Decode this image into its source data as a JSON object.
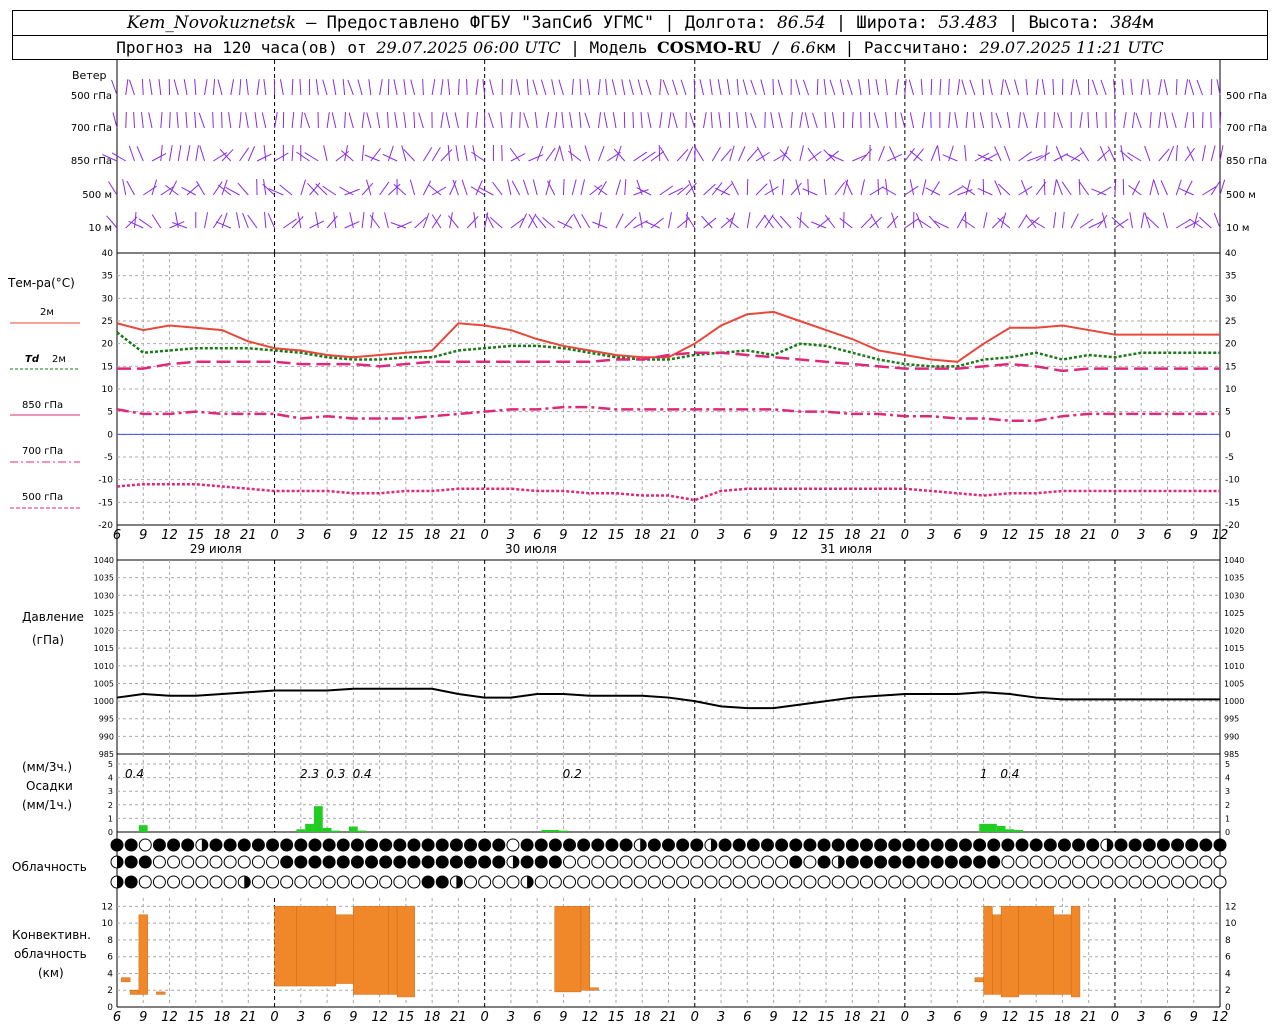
{
  "header": {
    "station": "Kem_Novokuznetsk",
    "provider": "Предоставлено ФГБУ \"ЗапСиб УГМС\"",
    "lon_label": "Долгота:",
    "lon": "86.54",
    "lat_label": "Широта:",
    "lat": "53.483",
    "alt_label": "Высота:",
    "alt": "384",
    "alt_unit": "м",
    "forecast_prefix": "Прогноз на 120 часа(ов) от",
    "forecast_start": "29.07.2025 06:00 UTC",
    "model_label": "Модель",
    "model": "COSMO-RU",
    "resolution": "6.6",
    "res_unit": "км",
    "computed_label": "Рассчитано:",
    "computed": "29.07.2025 11:21 UTC"
  },
  "time_axis": {
    "tick_labels": [
      "6",
      "9",
      "12",
      "15",
      "18",
      "21",
      "0",
      "3",
      "6",
      "9",
      "12",
      "15",
      "18",
      "21",
      "0",
      "3",
      "6",
      "9",
      "12",
      "15",
      "18",
      "21",
      "0",
      "3",
      "6",
      "9",
      "12"
    ],
    "day_labels": [
      "29 июля",
      "30 июля",
      "31 июля"
    ]
  },
  "labels": {
    "wind": "Ветер",
    "wind_levels": [
      "500 гПа",
      "700 гПа",
      "850 гПа",
      "500 м",
      "10 м"
    ],
    "temp_title": "Тем-ра(°С)",
    "legend_2m": "2м",
    "legend_td": "Td",
    "legend_td2": "2м",
    "legend_850": "850 гПа",
    "legend_700": "700 гПа",
    "legend_500": "500 гПа",
    "pressure_title": "Давление",
    "pressure_unit": "(гПа)",
    "precip_unit3": "(мм/3ч.)",
    "precip_title": "Осадки",
    "precip_unit1": "(мм/1ч.)",
    "cloud_title": "Облачность",
    "conv_title1": "Конвективн.",
    "conv_title2": "облачность",
    "conv_title3": "(км)"
  },
  "chart_data": [
    {
      "type": "line",
      "title": "Тем-ра(°С)",
      "ylim": [
        -20,
        40
      ],
      "yticks": [
        40,
        35,
        30,
        25,
        20,
        15,
        10,
        5,
        0,
        -5,
        -10,
        -15,
        -20
      ],
      "x_hours": [
        0,
        3,
        6,
        9,
        12,
        15,
        18,
        21,
        24,
        27,
        30,
        33,
        36,
        39,
        42,
        45,
        48,
        51,
        54,
        57,
        60,
        63,
        66,
        69,
        72,
        75,
        78,
        81,
        84,
        87,
        90,
        93,
        96,
        99,
        102,
        105,
        108,
        111,
        114,
        117,
        120,
        123,
        126
      ],
      "series": [
        {
          "name": "2м",
          "color": "#e8473a",
          "values": [
            24.5,
            23.0,
            24.0,
            23.5,
            23.0,
            20.5,
            19.0,
            18.5,
            17.5,
            17.0,
            17.5,
            18.0,
            18.5,
            24.5,
            24.0,
            23.0,
            21.0,
            19.5,
            18.5,
            17.5,
            17.0,
            17.0,
            20.0,
            24.0,
            26.5,
            27.0,
            25.0,
            23.0,
            21.0,
            18.5,
            17.5,
            16.5,
            16.0,
            20.0,
            23.5,
            23.5,
            24.0,
            23.0,
            22.0,
            22.0,
            22.0,
            22.0,
            22.0
          ]
        },
        {
          "name": "Td 2м",
          "color": "#1a7a1a",
          "values": [
            22.5,
            18.0,
            18.5,
            19.0,
            19.0,
            19.0,
            18.5,
            18.0,
            17.0,
            16.5,
            16.5,
            17.0,
            17.0,
            18.5,
            19.0,
            19.5,
            19.5,
            19.0,
            18.0,
            17.0,
            16.5,
            16.5,
            17.5,
            18.0,
            18.5,
            17.5,
            20.0,
            19.5,
            18.0,
            16.5,
            15.5,
            15.0,
            15.0,
            16.5,
            17.0,
            18.0,
            16.5,
            17.5,
            17.0,
            18.0,
            18.0,
            18.0,
            18.0
          ]
        },
        {
          "name": "850 гПа",
          "color": "#e0287a",
          "values": [
            14.5,
            14.5,
            15.5,
            16.0,
            16.0,
            16.0,
            16.0,
            15.5,
            15.5,
            15.5,
            15.0,
            15.5,
            16.0,
            16.0,
            16.0,
            16.0,
            16.0,
            16.0,
            16.0,
            16.5,
            16.5,
            17.5,
            18.0,
            18.0,
            17.5,
            17.0,
            16.5,
            16.0,
            15.5,
            15.0,
            14.5,
            14.5,
            14.5,
            15.0,
            15.5,
            15.0,
            14.0,
            14.5,
            14.5,
            14.5,
            14.5,
            14.5,
            14.5
          ]
        },
        {
          "name": "700 гПа",
          "color": "#e0287a",
          "values": [
            5.5,
            4.5,
            4.5,
            5.0,
            4.5,
            4.5,
            4.5,
            3.5,
            4.0,
            3.5,
            3.5,
            3.5,
            4.0,
            4.5,
            5.0,
            5.5,
            5.5,
            6.0,
            6.0,
            5.5,
            5.5,
            5.5,
            5.5,
            5.5,
            5.5,
            5.5,
            5.0,
            5.0,
            4.5,
            4.5,
            4.0,
            4.0,
            3.5,
            3.5,
            3.0,
            3.0,
            4.0,
            4.5,
            4.5,
            4.5,
            4.5,
            4.5,
            4.5
          ]
        },
        {
          "name": "500 гПа",
          "color": "#e0287a",
          "values": [
            -11.5,
            -11.0,
            -11.0,
            -11.0,
            -11.5,
            -12.0,
            -12.5,
            -12.5,
            -12.5,
            -13.0,
            -13.0,
            -12.5,
            -12.5,
            -12.0,
            -12.0,
            -12.0,
            -12.5,
            -12.5,
            -13.0,
            -13.0,
            -13.5,
            -13.5,
            -14.5,
            -12.5,
            -12.0,
            -12.0,
            -12.0,
            -12.0,
            -12.0,
            -12.0,
            -12.0,
            -12.5,
            -13.0,
            -13.5,
            -13.0,
            -13.0,
            -12.5,
            -12.5,
            -12.5,
            -12.5,
            -12.5,
            -12.5,
            -12.5
          ]
        }
      ]
    },
    {
      "type": "line",
      "title": "Давление",
      "ylim": [
        985,
        1040
      ],
      "yticks": [
        1040,
        1035,
        1030,
        1025,
        1020,
        1015,
        1010,
        1005,
        1000,
        995,
        990,
        985
      ],
      "x_hours": [
        0,
        3,
        6,
        9,
        12,
        15,
        18,
        21,
        24,
        27,
        30,
        33,
        36,
        39,
        42,
        45,
        48,
        51,
        54,
        57,
        60,
        63,
        66,
        69,
        72,
        75,
        78,
        81,
        84,
        87,
        90,
        93,
        96,
        99,
        102,
        105,
        108,
        111,
        114,
        117,
        120,
        123,
        126
      ],
      "series": [
        {
          "name": "p",
          "color": "#000000",
          "values": [
            1001,
            1002,
            1001.5,
            1001.5,
            1002,
            1002.5,
            1003,
            1003,
            1003,
            1003.5,
            1003.5,
            1003.5,
            1003.5,
            1002,
            1001,
            1001,
            1002,
            1002,
            1001.5,
            1001.5,
            1001.5,
            1001,
            1000,
            998.5,
            998,
            998,
            999,
            1000,
            1001,
            1001.5,
            1002,
            1002,
            1002,
            1002.5,
            1002,
            1001,
            1000.5,
            1000.5,
            1000.5,
            1000.5,
            1000.5,
            1000.5,
            1000.5
          ]
        }
      ]
    },
    {
      "type": "bar",
      "title": "Осадки",
      "ylim": [
        0,
        5
      ],
      "yticks": [
        5,
        4,
        3,
        2,
        1,
        0
      ],
      "bars": [
        {
          "h": 3,
          "v": 0.5
        },
        {
          "h": 21,
          "v": 0.2
        },
        {
          "h": 22,
          "v": 0.6
        },
        {
          "h": 23,
          "v": 1.9
        },
        {
          "h": 24,
          "v": 0.3
        },
        {
          "h": 25,
          "v": 0.1
        },
        {
          "h": 27,
          "v": 0.4
        },
        {
          "h": 28,
          "v": 0.1
        },
        {
          "h": 49,
          "v": 0.15
        },
        {
          "h": 50,
          "v": 0.15
        },
        {
          "h": 51,
          "v": 0.1
        },
        {
          "h": 99,
          "v": 0.6
        },
        {
          "h": 100,
          "v": 0.6
        },
        {
          "h": 101,
          "v": 0.45
        },
        {
          "h": 102,
          "v": 0.2
        },
        {
          "h": 103,
          "v": 0.15
        }
      ],
      "annotations": [
        {
          "h": 2,
          "text": "0.4"
        },
        {
          "h": 22,
          "text": "2.3"
        },
        {
          "h": 25,
          "text": "0.3"
        },
        {
          "h": 28,
          "text": "0.4"
        },
        {
          "h": 52,
          "text": "0.2"
        },
        {
          "h": 99,
          "text": "1"
        },
        {
          "h": 102,
          "text": "0.4"
        }
      ]
    },
    {
      "type": "bar",
      "title": "Конвективн. облачность (км)",
      "ylim": [
        0,
        13
      ],
      "yticks": [
        12,
        10,
        8,
        6,
        4,
        2,
        0
      ],
      "blocks": [
        {
          "h0": 0.5,
          "h1": 1.5,
          "bottom": 3.0,
          "top": 3.5
        },
        {
          "h0": 1.5,
          "h1": 2.5,
          "bottom": 1.5,
          "top": 2.0
        },
        {
          "h0": 2.5,
          "h1": 3.5,
          "bottom": 1.5,
          "top": 11.0
        },
        {
          "h0": 4.5,
          "h1": 5.5,
          "bottom": 1.5,
          "top": 1.8
        },
        {
          "h0": 18,
          "h1": 20.5,
          "bottom": 2.5,
          "top": 12
        },
        {
          "h0": 20.5,
          "h1": 25,
          "bottom": 2.5,
          "top": 12
        },
        {
          "h0": 25,
          "h1": 27,
          "bottom": 2.8,
          "top": 11
        },
        {
          "h0": 27,
          "h1": 31,
          "bottom": 1.5,
          "top": 12
        },
        {
          "h0": 31,
          "h1": 32,
          "bottom": 1.5,
          "top": 12
        },
        {
          "h0": 32,
          "h1": 34,
          "bottom": 1.2,
          "top": 12
        },
        {
          "h0": 50,
          "h1": 53,
          "bottom": 1.8,
          "top": 12
        },
        {
          "h0": 53,
          "h1": 54,
          "bottom": 2.0,
          "top": 12
        },
        {
          "h0": 54,
          "h1": 55,
          "bottom": 2.0,
          "top": 2.3
        },
        {
          "h0": 98,
          "h1": 99,
          "bottom": 3.0,
          "top": 3.5
        },
        {
          "h0": 99,
          "h1": 100,
          "bottom": 1.5,
          "top": 12
        },
        {
          "h0": 100,
          "h1": 101,
          "bottom": 1.5,
          "top": 11
        },
        {
          "h0": 101,
          "h1": 103,
          "bottom": 1.2,
          "top": 12
        },
        {
          "h0": 103,
          "h1": 107,
          "bottom": 1.5,
          "top": 12
        },
        {
          "h0": 107,
          "h1": 109,
          "bottom": 1.5,
          "top": 11
        },
        {
          "h0": 109,
          "h1": 110,
          "bottom": 1.2,
          "top": 12
        }
      ]
    }
  ],
  "colors": {
    "wind": "#8a2be2",
    "grid": "#aaaaaa",
    "precip": "#22cc22",
    "conv": "#f0882a",
    "zero_line": "#3a50e0"
  }
}
